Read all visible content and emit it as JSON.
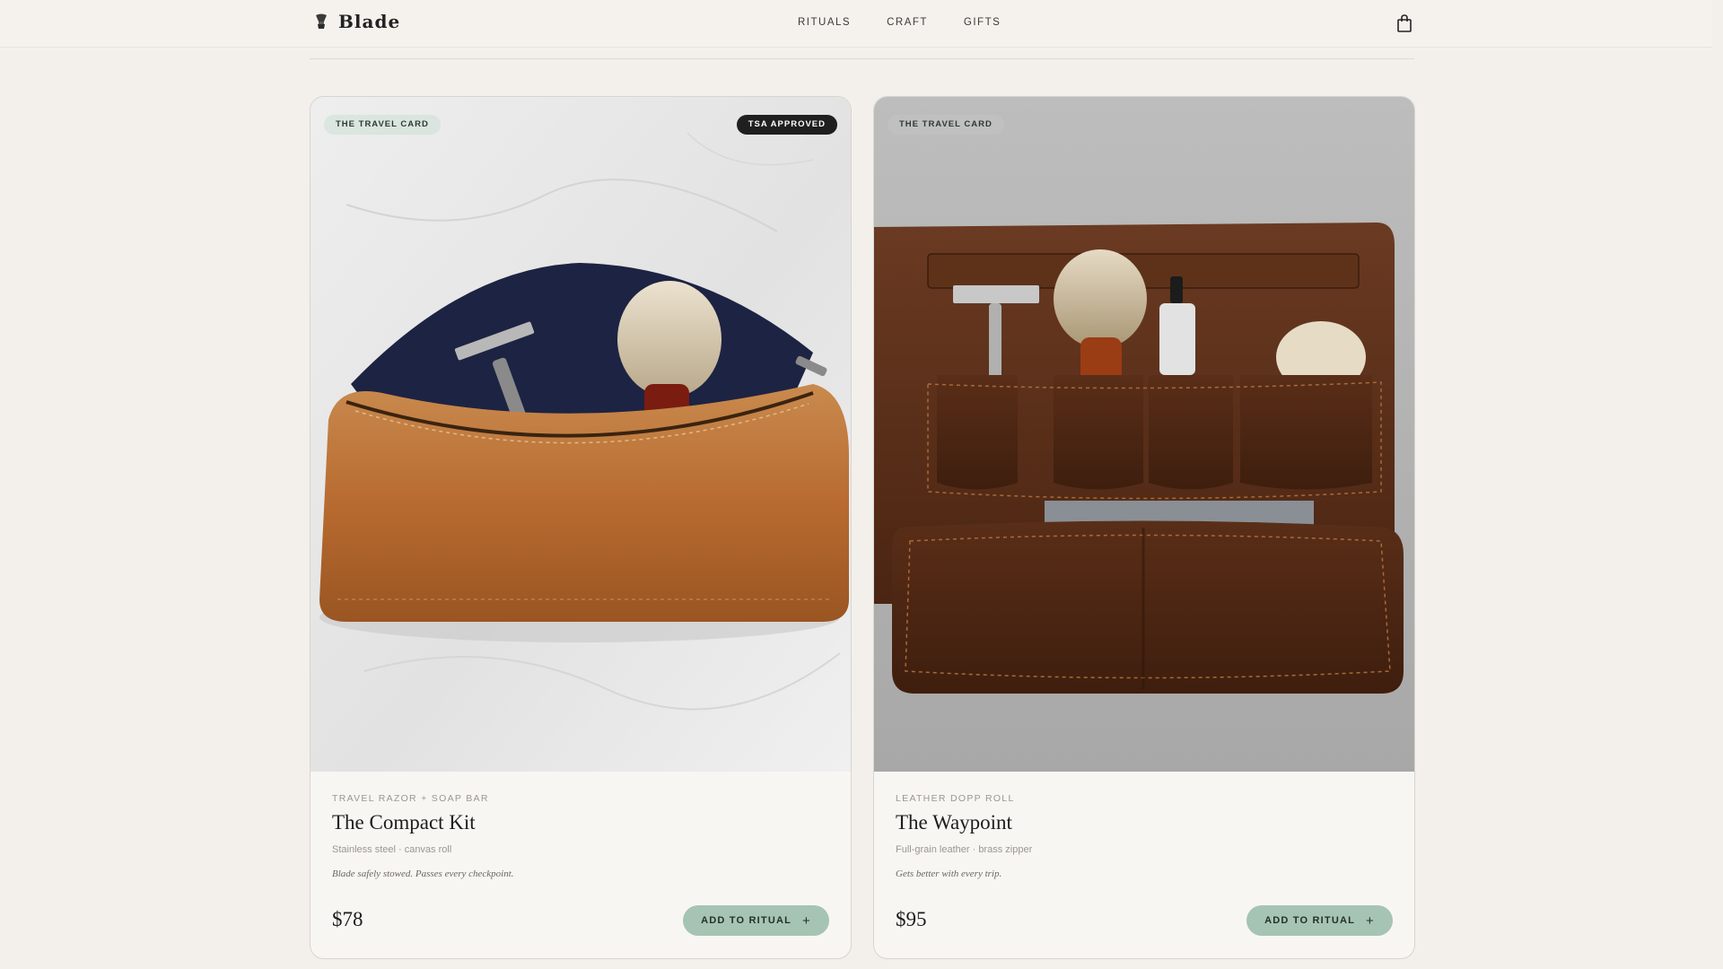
{
  "brand": {
    "name": "Blade",
    "mark_icon": "shaving-brush-icon"
  },
  "nav": {
    "items": [
      "RITUALS",
      "CRAFT",
      "GIFTS"
    ],
    "cart_icon": "shopping-bag-icon"
  },
  "colors": {
    "accent_button": "#a6c4b3",
    "page_background": "#f3f0ec",
    "badge_dark": "#1f1f1f"
  },
  "products": [
    {
      "tag": "THE TRAVEL CARD",
      "badge": "TSA APPROVED",
      "eyebrow": "TRAVEL RAZOR + SOAP BAR",
      "title": "The Compact Kit",
      "meta": "Stainless steel · canvas roll",
      "note": "Blade safely stowed. Passes every checkpoint.",
      "price": "$78",
      "cta": "ADD TO RITUAL",
      "cta_icon": "plus-icon",
      "image": "tan leather toiletry bag with safety razor and shaving brush"
    },
    {
      "tag": "THE TRAVEL CARD",
      "eyebrow": "LEATHER DOPP ROLL",
      "title": "The Waypoint",
      "meta": "Full-grain leather · brass zipper",
      "note": "Gets better with every trip.",
      "price": "$95",
      "cta": "ADD TO RITUAL",
      "cta_icon": "plus-icon",
      "image": "brown leather roll with razor, brush, oil bottle and soap tin"
    }
  ]
}
